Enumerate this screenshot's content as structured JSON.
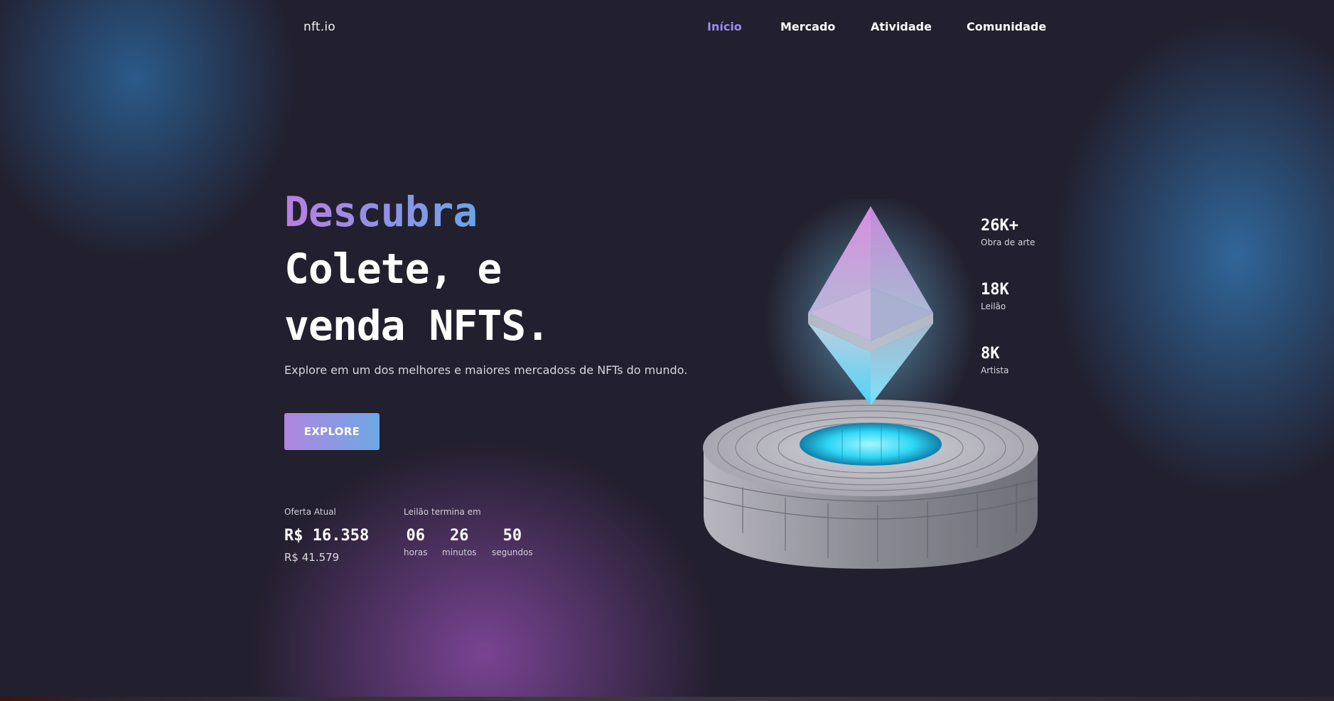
{
  "logo": "nft.io",
  "nav": {
    "items": [
      {
        "label": "Início",
        "active": true
      },
      {
        "label": "Mercado",
        "active": false
      },
      {
        "label": "Atividade",
        "active": false
      },
      {
        "label": "Comunidade",
        "active": false
      }
    ]
  },
  "hero": {
    "title_line1": "Descubra",
    "title_line2": "Colete, e",
    "title_line3": "venda NFTS.",
    "subtitle": "Explore em um dos melhores e maiores mercadoss de NFTs do mundo.",
    "cta_label": "EXPLORE"
  },
  "bid": {
    "label": "Oferta Atual",
    "value": "R$ 16.358",
    "secondary": "R$ 41.579"
  },
  "auction": {
    "label": "Leilão termina em",
    "units": [
      {
        "value": "06",
        "label": "horas"
      },
      {
        "value": "26",
        "label": "minutos"
      },
      {
        "value": "50",
        "label": "segundos"
      }
    ]
  },
  "stats": [
    {
      "value": "26K+",
      "label": "Obra de arte"
    },
    {
      "value": "18K",
      "label": "Leilão"
    },
    {
      "value": "8K",
      "label": "Artista"
    }
  ],
  "illustration": {
    "icon": "ethereum-crystal-pedestal-icon"
  },
  "colors": {
    "background": "#221f2e",
    "accent_purple": "#b77fe0",
    "accent_blue": "#4fb2e6",
    "nav_active": "#9c8cf0",
    "cyan_glow": "#3fe6ff"
  }
}
